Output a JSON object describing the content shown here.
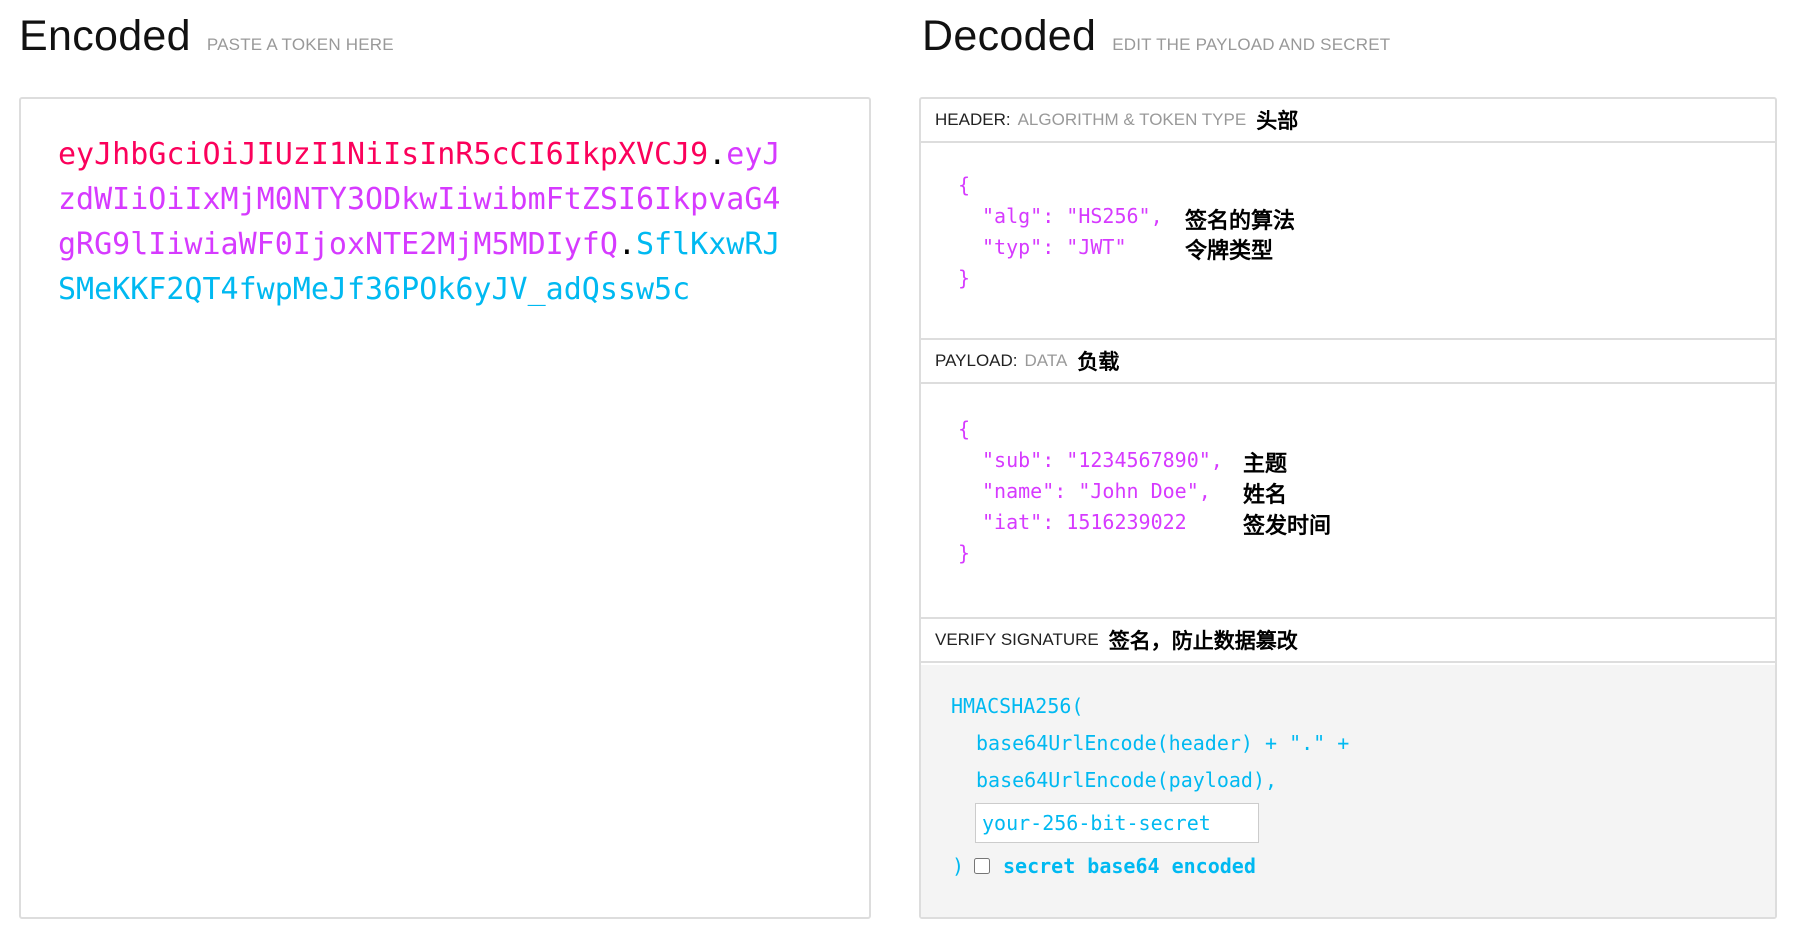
{
  "encoded": {
    "title": "Encoded",
    "subtitle": "PASTE A TOKEN HERE",
    "token": {
      "header": "eyJhbGciOiJIUzI1NiIsInR5cCI6IkpXVCJ9",
      "payload": "eyJzdWIiOiIxMjM0NTY3ODkwIiwibmFtZSI6IkpvaG4gRG9lIiwiaWF0IjoxNTE2MjM5MDIyfQ",
      "signature": "SflKxwRJSMeKKF2QT4fwpMeJf36POk6yJV_adQssw5c",
      "dot": "."
    }
  },
  "decoded": {
    "title": "Decoded",
    "subtitle": "EDIT THE PAYLOAD AND SECRET",
    "header_section": {
      "label": "HEADER:",
      "sublabel": "ALGORITHM & TOKEN TYPE",
      "cn": "头部",
      "open_brace": "{",
      "close_brace": "}",
      "line_alg": "\"alg\": \"HS256\",",
      "line_typ": "\"typ\": \"JWT\"",
      "note_alg": "签名的算法",
      "note_typ": "令牌类型"
    },
    "payload_section": {
      "label": "PAYLOAD:",
      "sublabel": "DATA",
      "cn": "负载",
      "open_brace": "{",
      "close_brace": "}",
      "line_sub": "\"sub\": \"1234567890\",",
      "line_name": "\"name\": \"John Doe\",",
      "line_iat": "\"iat\": 1516239022",
      "note_sub": "主题",
      "note_name": "姓名",
      "note_iat": "签发时间"
    },
    "signature_section": {
      "label": "VERIFY SIGNATURE",
      "cn": "签名，防止数据篡改",
      "line1": "HMACSHA256(",
      "line2": "base64UrlEncode(header) + \".\" +",
      "line3": "base64UrlEncode(payload),",
      "secret_placeholder": "your-256-bit-secret",
      "close_paren": ")",
      "checkbox_label": "secret base64 encoded"
    }
  },
  "colors": {
    "header": "#fb015b",
    "payload": "#d63aff",
    "signature": "#00b9f1"
  }
}
